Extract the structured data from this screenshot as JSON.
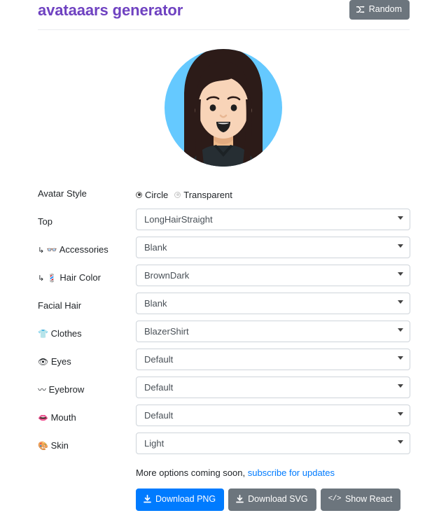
{
  "header": {
    "title": "avataaars generator",
    "random_button": {
      "label": "Random",
      "icon": "shuffle-icon"
    }
  },
  "avatar": {
    "style": "Circle",
    "colors": {
      "circle_background": "#65C9FF",
      "hair": "#2C1B18",
      "skin": "#F8D4B8",
      "clothes": "#262E33",
      "mouth": "#000000",
      "eyes": "#000000",
      "nose_shadow": "#E8B793"
    }
  },
  "form": {
    "avatar_style": {
      "label": "Avatar Style",
      "options": [
        "Circle",
        "Transparent"
      ],
      "selected": "Circle"
    },
    "fields": [
      {
        "label": "Top",
        "prefix": "",
        "icon": "",
        "value": "LongHairStraight",
        "name": "top"
      },
      {
        "label": "Accessories",
        "prefix": "↳",
        "icon": "👓",
        "value": "Blank",
        "name": "accessories"
      },
      {
        "label": "Hair Color",
        "prefix": "↳",
        "icon": "💈",
        "value": "BrownDark",
        "name": "hair-color"
      },
      {
        "label": "Facial Hair",
        "prefix": "",
        "icon": "",
        "value": "Blank",
        "name": "facial-hair"
      },
      {
        "label": "Clothes",
        "prefix": "",
        "icon": "👕",
        "value": "BlazerShirt",
        "name": "clothes"
      },
      {
        "label": "Eyes",
        "prefix": "",
        "icon": "👁",
        "value": "Default",
        "name": "eyes"
      },
      {
        "label": "Eyebrow",
        "prefix": "",
        "icon": "〰",
        "value": "Default",
        "name": "eyebrow"
      },
      {
        "label": "Mouth",
        "prefix": "",
        "icon": "👄",
        "value": "Default",
        "name": "mouth"
      },
      {
        "label": "Skin",
        "prefix": "",
        "icon": "🎨",
        "value": "Light",
        "name": "skin"
      }
    ]
  },
  "footer": {
    "note_text": "More options coming soon,",
    "note_link": "subscribe for updates",
    "buttons": [
      {
        "label": "Download PNG",
        "icon": "download-icon",
        "style": "primary",
        "name": "download-png"
      },
      {
        "label": "Download SVG",
        "icon": "download-icon",
        "style": "secondary",
        "name": "download-svg"
      },
      {
        "label": "Show React",
        "icon": "code-icon",
        "style": "secondary",
        "name": "show-react"
      }
    ]
  },
  "colors": {
    "brand_purple": "#6f42c1",
    "link_blue": "#007bff",
    "secondary_gray": "#6c757d"
  }
}
